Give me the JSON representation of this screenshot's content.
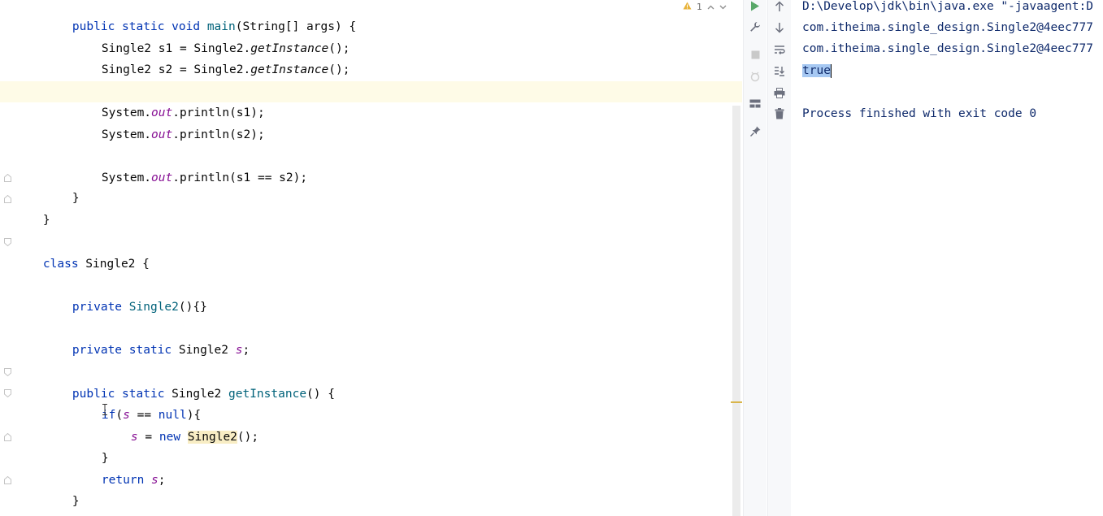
{
  "editor": {
    "inspection_count": "1",
    "lines": {
      "l1": {
        "kw1": "public",
        "kw2": "static",
        "kw3": "void",
        "name": "main",
        "rest": "(String[] args) {"
      },
      "l2": {
        "prefix": "Single2 s1 = Single2.",
        "call": "getInstance",
        "suffix": "();"
      },
      "l3": {
        "prefix": "Single2 s2 = Single2.",
        "call": "getInstance",
        "suffix": "();"
      },
      "l5": {
        "prefix": "System.",
        "field": "out",
        "suffix": ".println(s1);"
      },
      "l6": {
        "prefix": "System.",
        "field": "out",
        "suffix": ".println(s2);"
      },
      "l8": {
        "prefix": "System.",
        "field": "out",
        "suffix": ".println(s1 == s2);"
      },
      "l9": {
        "text": "}"
      },
      "l10": {
        "text": "}"
      },
      "l12": {
        "kw": "class",
        "rest": " Single2 {"
      },
      "l14": {
        "kw": "private",
        "ctor": "Single2",
        "rest": "(){}"
      },
      "l16": {
        "kw1": "private",
        "kw2": "static",
        "type": "Single2 ",
        "field": "s",
        "rest": ";"
      },
      "l18": {
        "kw1": "public",
        "kw2": "static",
        "type": "Single2 ",
        "name": "getInstance",
        "rest": "() {"
      },
      "l19": {
        "kw": "if",
        "open": "(",
        "field": "s",
        "mid": " == ",
        "kw2": "null",
        "rest": "){"
      },
      "l20": {
        "field": "s",
        "mid": " = ",
        "kw": "new",
        "sp": " ",
        "ctor": "Single2",
        "rest": "();"
      },
      "l21": {
        "text": "}"
      },
      "l22": {
        "kw": "return",
        "sp": " ",
        "field": "s",
        "rest": ";"
      },
      "l23": {
        "text": "}"
      }
    }
  },
  "console": {
    "lines": [
      "D:\\Develop\\jdk\\bin\\java.exe \"-javaagent:D",
      "com.itheima.single_design.Single2@4eec777",
      "com.itheima.single_design.Single2@4eec777",
      "true",
      "",
      "Process finished with exit code 0"
    ]
  },
  "icons": {
    "run_toolbar": [
      "run-icon",
      "wrench-icon",
      "stop-icon",
      "rerun-failed-icon",
      "layout-icon",
      "pin-icon"
    ],
    "console_toolbar": [
      "arrow-up-icon",
      "arrow-down-icon",
      "soft-wrap-icon",
      "scroll-to-end-icon",
      "print-icon",
      "trash-icon"
    ],
    "warning": "warning-icon"
  },
  "colors": {
    "keyword": "#0033b3",
    "field": "#871094",
    "declaration": "#00627a",
    "current_line": "#fefbe7",
    "selection": "#a6c8f2",
    "console_text": "#0f2a6b",
    "run_green": "#59a869"
  }
}
